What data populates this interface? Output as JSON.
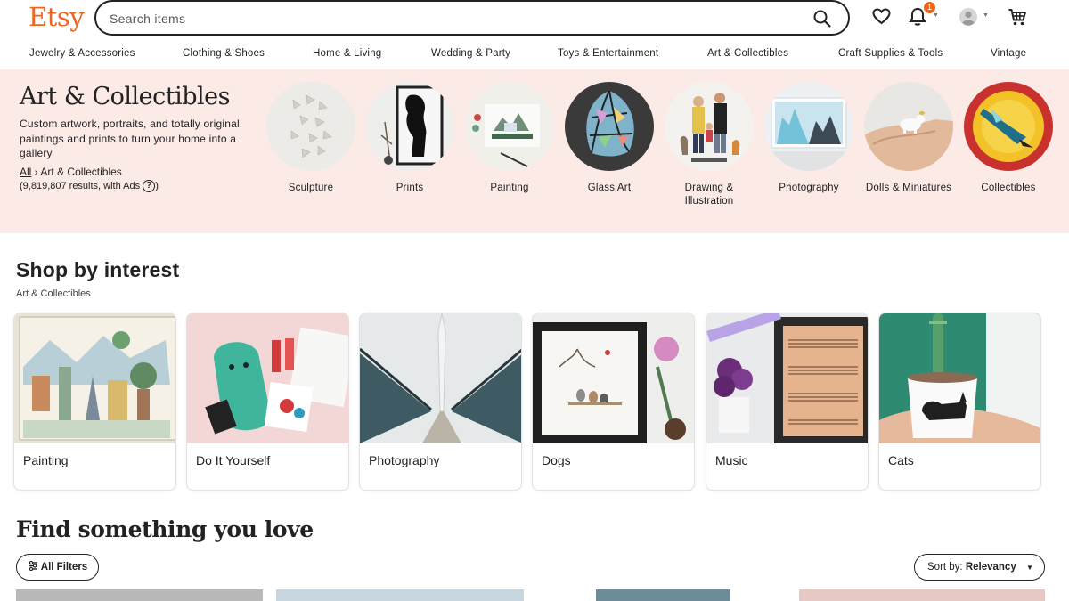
{
  "header": {
    "logo": "Etsy",
    "search_placeholder": "Search items",
    "notification_count": "1",
    "icons": [
      "search-icon",
      "heart-icon",
      "bell-icon",
      "avatar-icon",
      "cart-icon"
    ]
  },
  "categories": [
    "Jewelry & Accessories",
    "Clothing & Shoes",
    "Home & Living",
    "Wedding & Party",
    "Toys & Entertainment",
    "Art & Collectibles",
    "Craft Supplies & Tools",
    "Vintage"
  ],
  "hero": {
    "title": "Art & Collectibles",
    "description": "Custom artwork, portraits, and totally original paintings and prints to turn your home into a gallery",
    "breadcrumb_all": "All",
    "breadcrumb_current": "Art & Collectibles",
    "results": "(9,819,807 results, with Ads",
    "results_end": ")",
    "help_glyph": "?",
    "background": "#FBEAE5",
    "subcategories": [
      {
        "label": "Sculpture"
      },
      {
        "label": "Prints"
      },
      {
        "label": "Painting"
      },
      {
        "label": "Glass Art"
      },
      {
        "label": "Drawing & Illustration"
      },
      {
        "label": "Photography"
      },
      {
        "label": "Dolls & Miniatures"
      },
      {
        "label": "Collectibles"
      }
    ]
  },
  "shop_by_interest": {
    "title": "Shop by interest",
    "subtitle": "Art & Collectibles",
    "cards": [
      {
        "label": "Painting"
      },
      {
        "label": "Do It Yourself"
      },
      {
        "label": "Photography"
      },
      {
        "label": "Dogs"
      },
      {
        "label": "Music"
      },
      {
        "label": "Cats"
      }
    ]
  },
  "find": {
    "title": "Find something you love",
    "filters_label": "All Filters",
    "sort_prefix": "Sort by: ",
    "sort_value": "Relevancy"
  },
  "colors": {
    "brand": "#F1641E",
    "text": "#222222"
  }
}
